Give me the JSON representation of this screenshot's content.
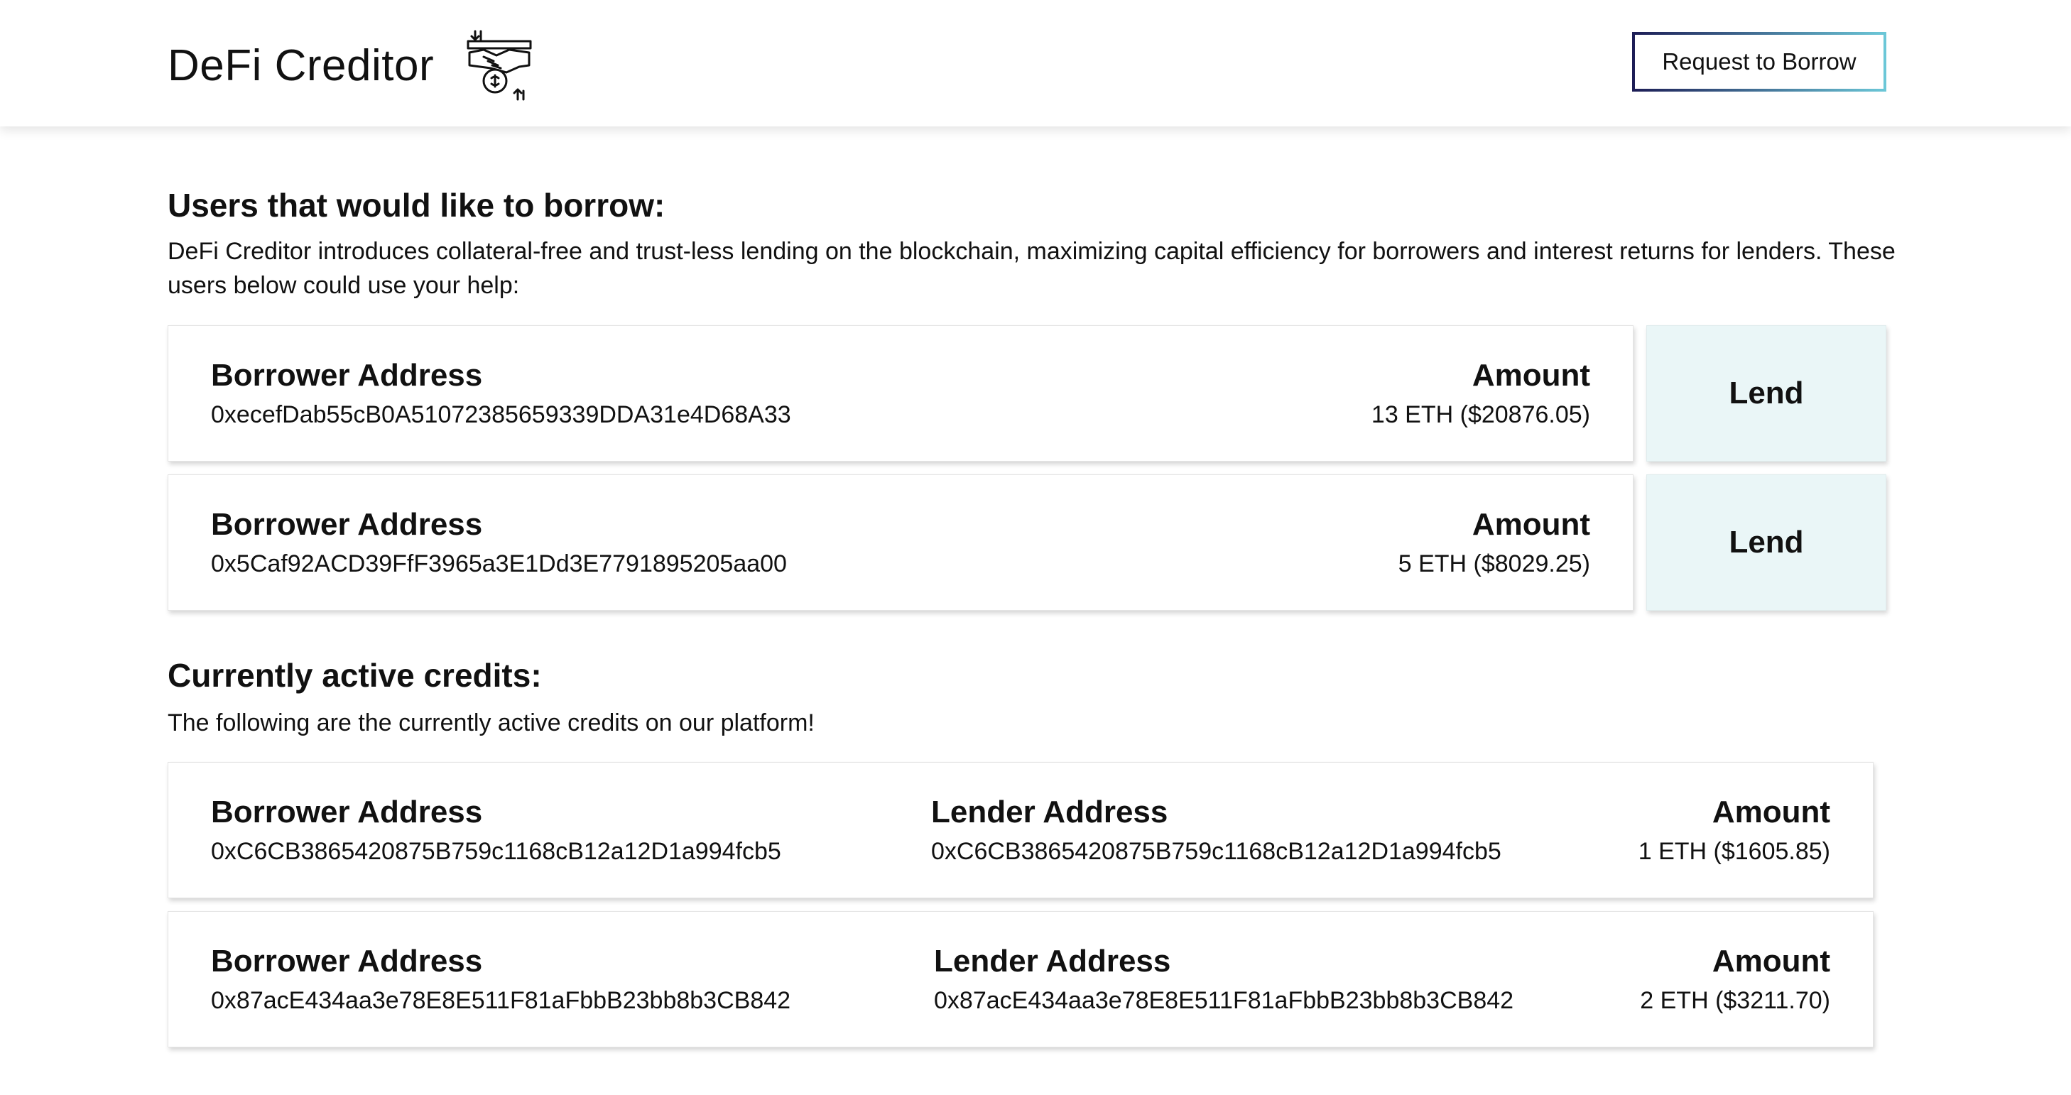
{
  "header": {
    "brand_title": "DeFi Creditor",
    "logo_icon": "handshake-exchange-icon",
    "request_button": "Request to Borrow"
  },
  "borrow_section": {
    "title": "Users that would like to borrow:",
    "description": "DeFi Creditor introduces collateral-free and trust-less lending on the blockchain, maximizing capital efficiency for borrowers and interest returns for lenders. These users below could use your help:",
    "requests": [
      {
        "borrower_label": "Borrower Address",
        "borrower_address": "0xecefDab55cB0A51072385659339DDA31e4D68A33",
        "amount_label": "Amount",
        "amount": "13 ETH ($20876.05)",
        "lend_label": "Lend"
      },
      {
        "borrower_label": "Borrower Address",
        "borrower_address": "0x5Caf92ACD39FfF3965a3E1Dd3E7791895205aa00",
        "amount_label": "Amount",
        "amount": "5 ETH ($8029.25)",
        "lend_label": "Lend"
      }
    ]
  },
  "active_section": {
    "title": "Currently active credits:",
    "description": "The following are the currently active credits on our platform!",
    "credits": [
      {
        "borrower_label": "Borrower Address",
        "borrower_address": "0xC6CB3865420875B759c1168cB12a12D1a994fcb5",
        "lender_label": "Lender Address",
        "lender_address": "0xC6CB3865420875B759c1168cB12a12D1a994fcb5",
        "amount_label": "Amount",
        "amount": "1 ETH ($1605.85)"
      },
      {
        "borrower_label": "Borrower Address",
        "borrower_address": "0x87acE434aa3e78E8E511F81aFbbB23bb8b3CB842",
        "lender_label": "Lender Address",
        "lender_address": "0x87acE434aa3e78E8E511F81aFbbB23bb8b3CB842",
        "amount_label": "Amount",
        "amount": "2 ETH ($3211.70)"
      }
    ]
  }
}
